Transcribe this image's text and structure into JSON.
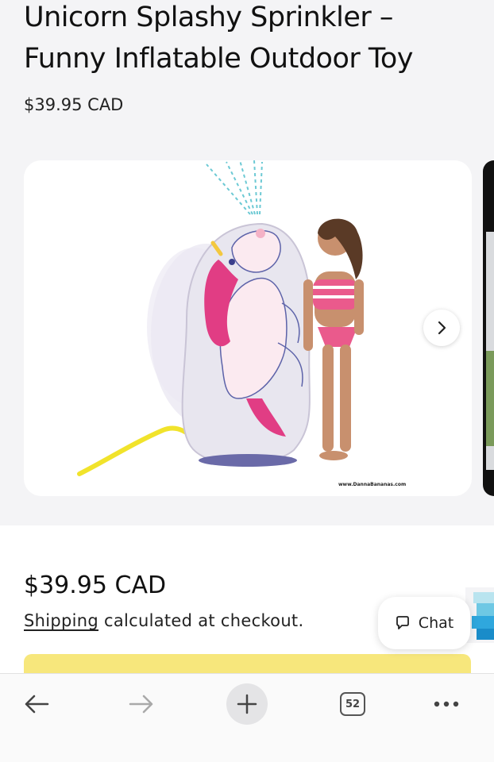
{
  "product": {
    "title_line1": "Unicorn Splashy Sprinkler –",
    "title_line2": "Funny Inflatable Outdoor Toy",
    "price": "$39.95 CAD"
  },
  "gallery": {
    "watermark": "www.DannaBananas.com",
    "next_icon": "chevron-right-icon"
  },
  "purchase": {
    "price": "$39.95 CAD",
    "shipping_link": "Shipping",
    "shipping_text": " calculated at checkout."
  },
  "chat": {
    "label": "Chat",
    "icon": "chat-bubble-icon"
  },
  "browser_nav": {
    "back_icon": "arrow-left-icon",
    "forward_icon": "arrow-right-icon",
    "new_tab_icon": "plus-icon",
    "tab_count": "52",
    "menu_icon": "more-horizontal-icon"
  },
  "colors": {
    "buy_button": "#f7e77c",
    "background": "#f4f4f6"
  }
}
